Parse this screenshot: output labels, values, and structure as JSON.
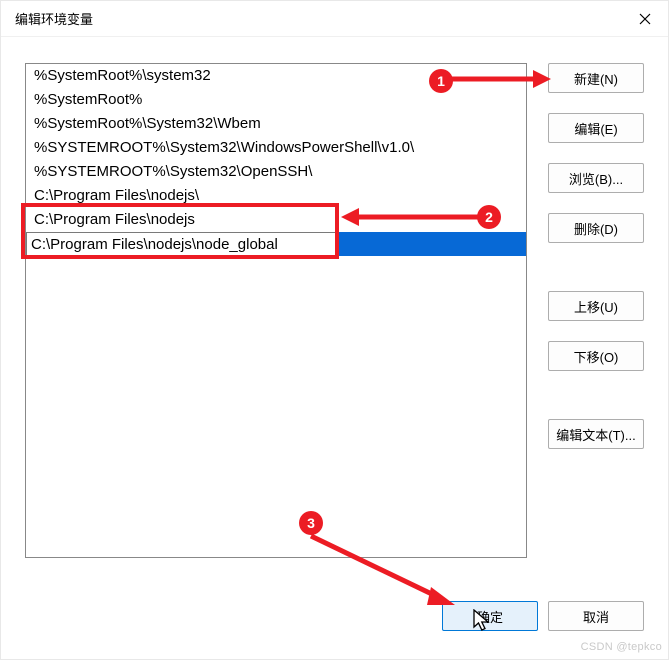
{
  "dialog": {
    "title": "编辑环境变量"
  },
  "list": {
    "items": [
      "%SystemRoot%\\system32",
      "%SystemRoot%",
      "%SystemRoot%\\System32\\Wbem",
      "%SYSTEMROOT%\\System32\\WindowsPowerShell\\v1.0\\",
      "%SYSTEMROOT%\\System32\\OpenSSH\\",
      "C:\\Program Files\\nodejs\\",
      "C:\\Program Files\\nodejs",
      "C:\\Program Files\\nodejs\\node_global"
    ],
    "selected_index": 7,
    "editing_index": 7,
    "edit_value": "C:\\Program Files\\nodejs\\node_global"
  },
  "buttons": {
    "new": "新建(N)",
    "edit": "编辑(E)",
    "browse": "浏览(B)...",
    "delete": "删除(D)",
    "move_up": "上移(U)",
    "move_down": "下移(O)",
    "edit_text": "编辑文本(T)...",
    "ok": "确定",
    "cancel": "取消"
  },
  "annotations": {
    "badge1": "1",
    "badge2": "2",
    "badge3": "3"
  },
  "watermark": "CSDN @tepkco"
}
